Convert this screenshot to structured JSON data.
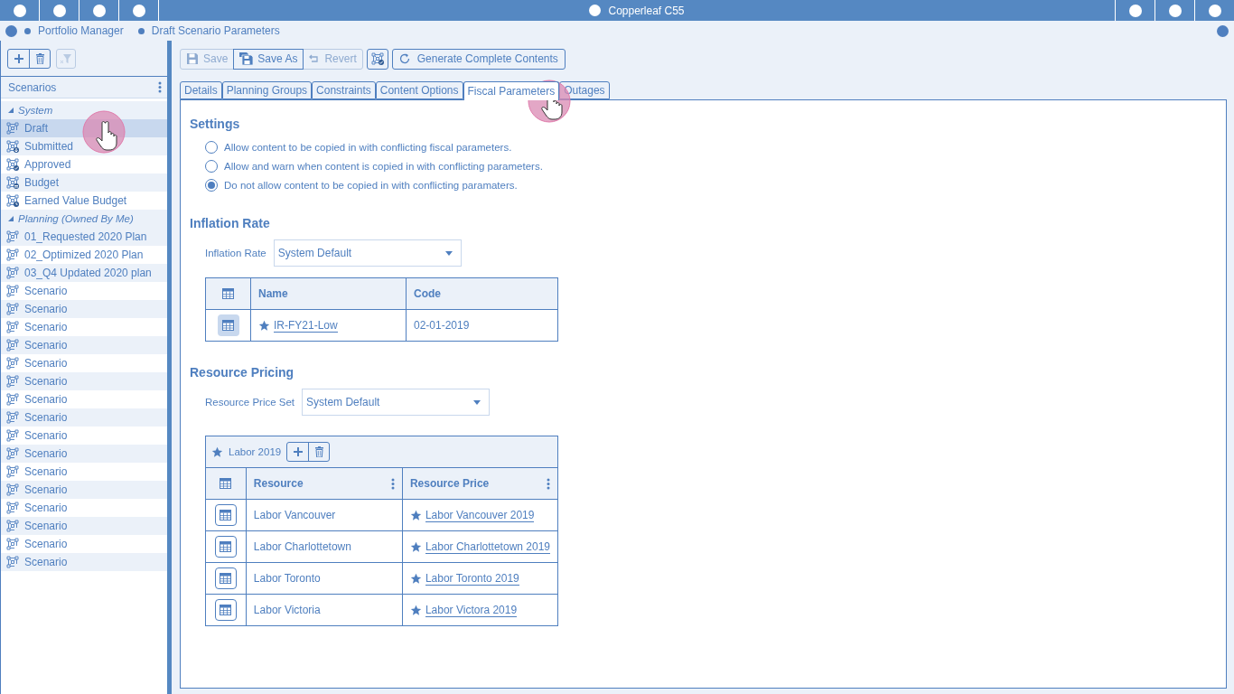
{
  "title_bar": {
    "title": "Copperleaf C55"
  },
  "breadcrumb": [
    "Portfolio Manager",
    "Draft Scenario Parameters"
  ],
  "sidebar": {
    "title": "Scenarios",
    "groups": [
      {
        "label": "System",
        "expanded": true,
        "items": [
          {
            "label": "Draft",
            "kind": "draft",
            "selected": true
          },
          {
            "label": "Submitted",
            "kind": "submitted",
            "selected": false
          },
          {
            "label": "Approved",
            "kind": "approved",
            "selected": false
          },
          {
            "label": "Budget",
            "kind": "budget",
            "selected": false
          },
          {
            "label": "Earned Value Budget",
            "kind": "earned",
            "selected": false
          }
        ]
      },
      {
        "label": "Planning (Owned By Me)",
        "expanded": true,
        "items": [
          {
            "label": "01_Requested 2020 Plan",
            "kind": "draft",
            "selected": false
          },
          {
            "label": "02_Optimized 2020 Plan",
            "kind": "draft",
            "selected": false
          },
          {
            "label": "03_Q4 Updated 2020 plan",
            "kind": "draft",
            "selected": false
          },
          {
            "label": "Scenario",
            "kind": "draft",
            "selected": false
          },
          {
            "label": "Scenario",
            "kind": "draft",
            "selected": false
          },
          {
            "label": "Scenario",
            "kind": "draft",
            "selected": false
          },
          {
            "label": "Scenario",
            "kind": "draft",
            "selected": false
          },
          {
            "label": "Scenario",
            "kind": "draft",
            "selected": false
          },
          {
            "label": "Scenario",
            "kind": "draft",
            "selected": false
          },
          {
            "label": "Scenario",
            "kind": "draft",
            "selected": false
          },
          {
            "label": "Scenario",
            "kind": "draft",
            "selected": false
          },
          {
            "label": "Scenario",
            "kind": "draft",
            "selected": false
          },
          {
            "label": "Scenario",
            "kind": "draft",
            "selected": false
          },
          {
            "label": "Scenario",
            "kind": "draft",
            "selected": false
          },
          {
            "label": "Scenario",
            "kind": "draft",
            "selected": false
          },
          {
            "label": "Scenario",
            "kind": "draft",
            "selected": false
          },
          {
            "label": "Scenario",
            "kind": "draft",
            "selected": false
          },
          {
            "label": "Scenario",
            "kind": "draft",
            "selected": false
          },
          {
            "label": "Scenario",
            "kind": "draft",
            "selected": false
          }
        ]
      }
    ]
  },
  "toolbar": {
    "buttons": [
      {
        "label": "Save",
        "kind": "save",
        "disabled": true
      },
      {
        "label": "Save As",
        "kind": "saveas",
        "disabled": false
      },
      {
        "label": "Revert",
        "kind": "revert",
        "disabled": true
      }
    ],
    "generate": "Generate Complete Contents"
  },
  "tabs": [
    {
      "label": "Details",
      "selected": false
    },
    {
      "label": "Planning Groups",
      "selected": false
    },
    {
      "label": "Constraints",
      "selected": false
    },
    {
      "label": "Content Options",
      "selected": false
    },
    {
      "label": "Fiscal Parameters",
      "selected": true
    },
    {
      "label": "Outages",
      "selected": false
    }
  ],
  "settings": {
    "title": "Settings",
    "options": [
      {
        "label": "Allow content to be copied in with conflicting fiscal parameters.",
        "selected": false
      },
      {
        "label": "Allow and warn when content is copied in with conflicting parameters.",
        "selected": false
      },
      {
        "label": "Do not allow content to be copied in with conflicting paramaters.",
        "selected": true
      }
    ]
  },
  "inflation": {
    "title": "Inflation Rate",
    "field_label": "Inflation Rate",
    "value": "System Default",
    "columns": [
      "Name",
      "Code"
    ],
    "rows": [
      {
        "name": "IR-FY21-Low",
        "code": "02-01-2019",
        "selected": true
      }
    ]
  },
  "resource_pricing": {
    "title": "Resource Pricing",
    "field_label": "Resource Price Set",
    "value": "System Default",
    "set_name": "Labor 2019",
    "columns": [
      "Resource",
      "Resource Price"
    ],
    "rows": [
      {
        "resource": "Labor Vancouver",
        "price": "Labor Vancouver 2019",
        "selected": false
      },
      {
        "resource": "Labor Charlottetown",
        "price": "Labor Charlottetown 2019",
        "selected": false
      },
      {
        "resource": "Labor Toronto",
        "price": "Labor Toronto 2019",
        "selected": false
      },
      {
        "resource": "Labor Victoria",
        "price": "Labor Victora 2019",
        "selected": false
      }
    ]
  }
}
